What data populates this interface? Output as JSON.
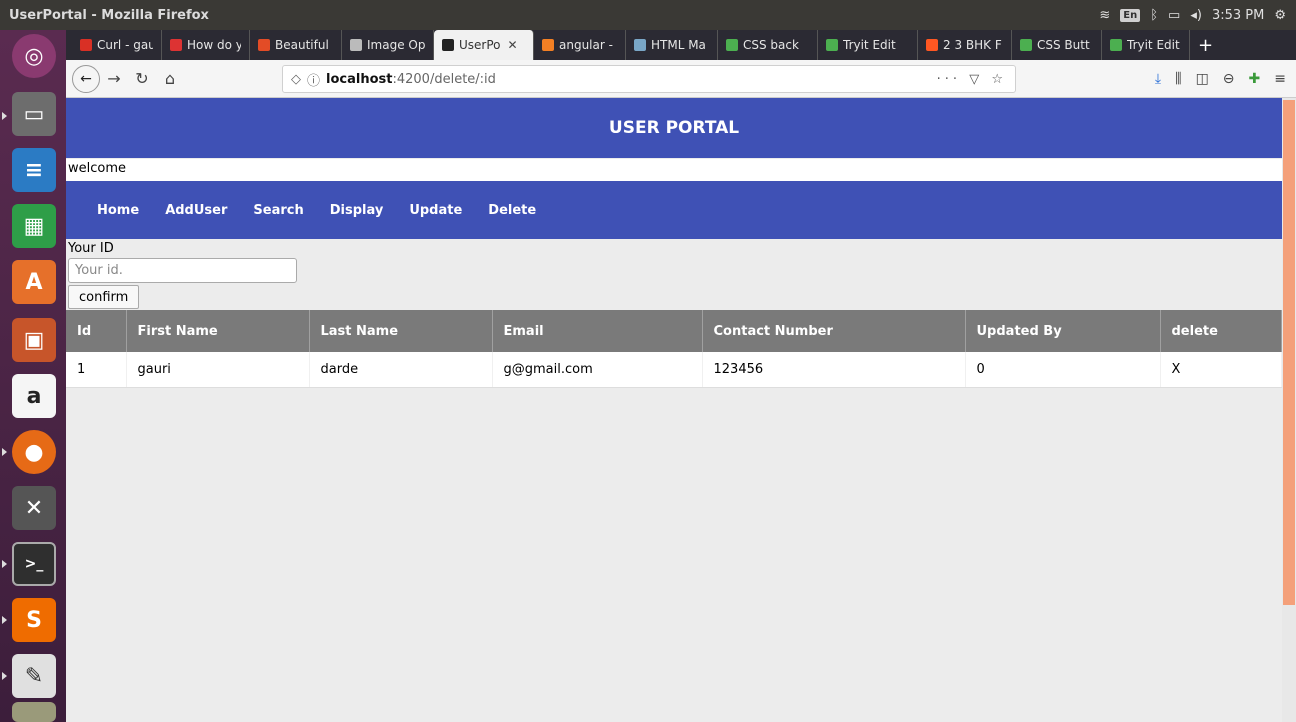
{
  "window": {
    "title": "UserPortal - Mozilla Firefox",
    "clock": "3:53 PM",
    "lang": "En"
  },
  "tabs": [
    {
      "label": "Curl - gau",
      "color": "#d93025"
    },
    {
      "label": "How do y",
      "color": "#d33"
    },
    {
      "label": "Beautiful",
      "color": "#e34c26"
    },
    {
      "label": "Image Op",
      "color": "#bbbbbb"
    },
    {
      "label": "UserPo",
      "color": "#222222",
      "active": true
    },
    {
      "label": "angular -",
      "color": "#f48024"
    },
    {
      "label": "HTML Ma",
      "color": "#7aa7c7"
    },
    {
      "label": "CSS back",
      "color": "#4caf50"
    },
    {
      "label": "Tryit Edit",
      "color": "#4caf50"
    },
    {
      "label": "2 3 BHK F",
      "color": "#ff5722"
    },
    {
      "label": "CSS Butt",
      "color": "#4caf50"
    },
    {
      "label": "Tryit Edit",
      "color": "#4caf50"
    }
  ],
  "urlbar": {
    "host": "localhost",
    "path": ":4200/delete/:id"
  },
  "app": {
    "title": "USER PORTAL",
    "welcome": "welcome",
    "menu": [
      "Home",
      "AddUser",
      "Search",
      "Display",
      "Update",
      "Delete"
    ],
    "form": {
      "label": "Your ID",
      "placeholder": "Your id.",
      "button": "confirm"
    },
    "table": {
      "headers": [
        "Id",
        "First Name",
        "Last Name",
        "Email",
        "Contact Number",
        "Updated By",
        "delete"
      ],
      "rows": [
        [
          "1",
          "gauri",
          "darde",
          "g@gmail.com",
          "123456",
          "0",
          "X"
        ]
      ]
    }
  },
  "icons": {
    "launcher": [
      "ubuntu-icon",
      "files-icon",
      "writer-icon",
      "calc-icon",
      "software-icon",
      "impress-icon",
      "amazon-icon",
      "firefox-icon",
      "settings-icon",
      "terminal-icon",
      "sublime-icon",
      "editor-icon",
      "trash-icon"
    ]
  }
}
